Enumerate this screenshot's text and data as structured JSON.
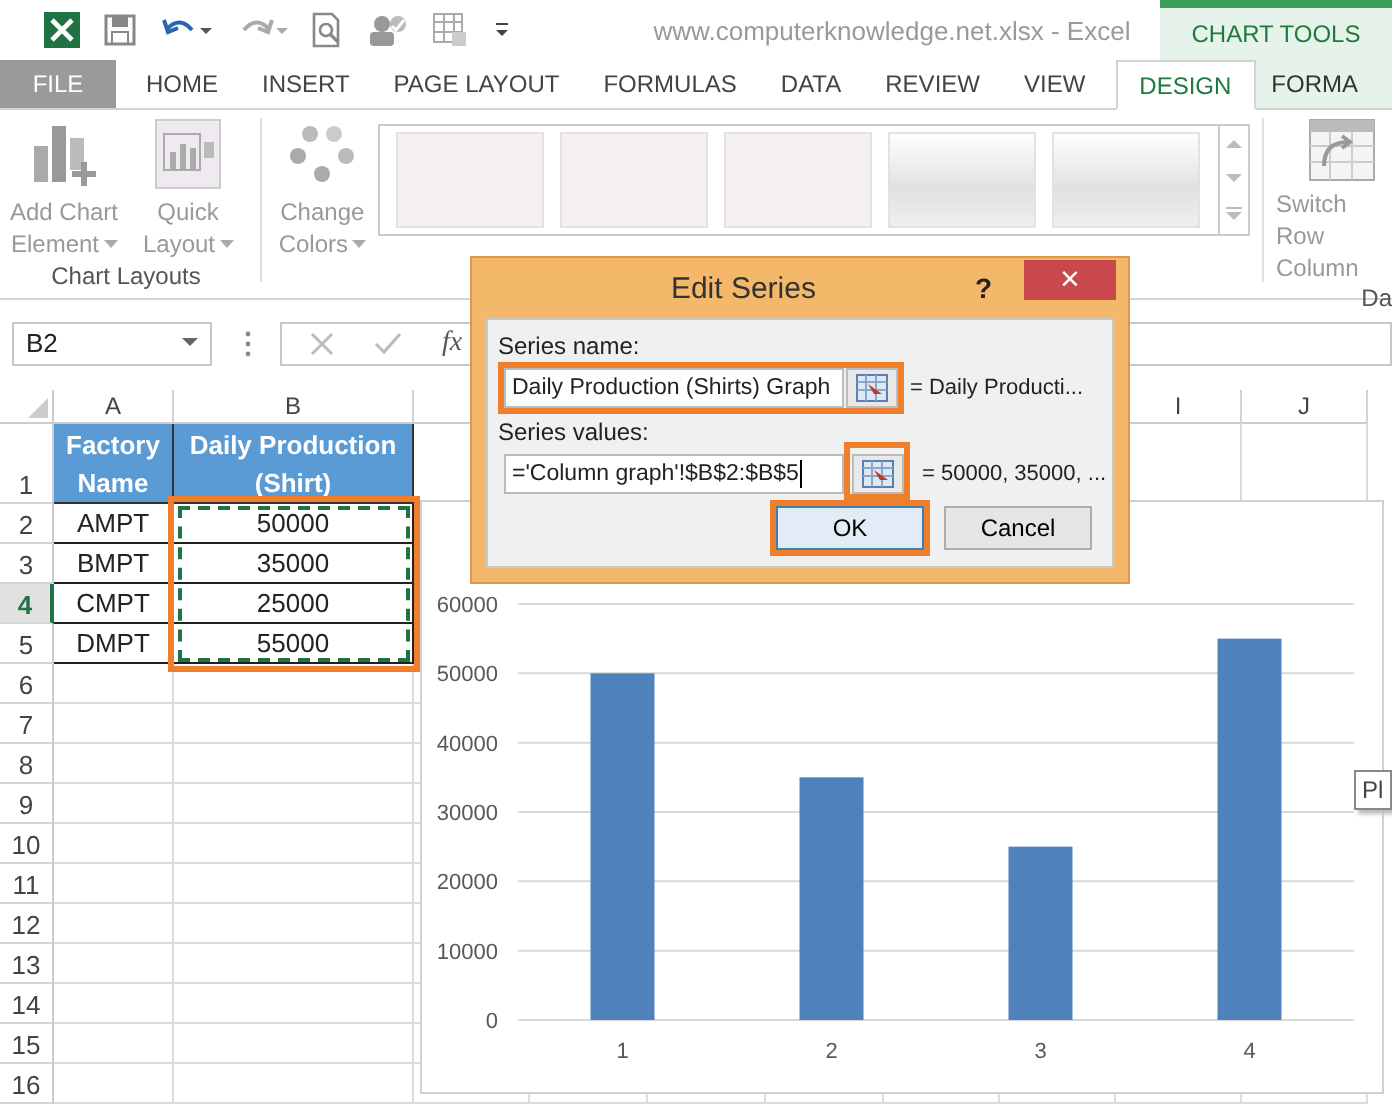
{
  "title_bar": {
    "title": "www.computerknowledge.net.xlsx - Excel",
    "context_label": "CHART TOOLS"
  },
  "tabs": [
    {
      "label": "FILE",
      "selected": false,
      "kind": "file"
    },
    {
      "label": "HOME",
      "selected": false,
      "kind": "main"
    },
    {
      "label": "INSERT",
      "selected": false,
      "kind": "main"
    },
    {
      "label": "PAGE LAYOUT",
      "selected": false,
      "kind": "main"
    },
    {
      "label": "FORMULAS",
      "selected": false,
      "kind": "main"
    },
    {
      "label": "DATA",
      "selected": false,
      "kind": "main"
    },
    {
      "label": "REVIEW",
      "selected": false,
      "kind": "main"
    },
    {
      "label": "VIEW",
      "selected": false,
      "kind": "main"
    },
    {
      "label": "DESIGN",
      "selected": true,
      "kind": "context"
    },
    {
      "label": "FORMA",
      "selected": false,
      "kind": "context"
    }
  ],
  "ribbon": {
    "groups": [
      {
        "label": "Chart Layouts",
        "buttons": [
          {
            "label": "Add Chart Element",
            "kind": "add-chart",
            "dropdown": true
          },
          {
            "label": "Quick Layout",
            "kind": "quick-layout",
            "dropdown": true
          }
        ]
      }
    ],
    "change_colors": {
      "label": "Change Colors",
      "kind": "change-colors",
      "dropdown": true
    },
    "switch": {
      "label": "Switch Row Column",
      "kind": "switch",
      "dropdown": false
    },
    "cut_group_label": "Da"
  },
  "formula_bar": {
    "name_box": "B2",
    "fx": "fx"
  },
  "sheet": {
    "columns": [
      "A",
      "B",
      "I",
      "J"
    ],
    "rows": [
      {
        "number": "1",
        "selected": false,
        "kind": "header",
        "cells": [
          "Factory Name",
          "Daily Production (Shirt)"
        ]
      },
      {
        "number": "2",
        "selected": false,
        "kind": "data",
        "cells": [
          "AMPT",
          "50000"
        ]
      },
      {
        "number": "3",
        "selected": false,
        "kind": "data",
        "cells": [
          "BMPT",
          "35000"
        ]
      },
      {
        "number": "4",
        "selected": true,
        "kind": "data",
        "cells": [
          "CMPT",
          "25000"
        ]
      },
      {
        "number": "5",
        "selected": false,
        "kind": "data",
        "cells": [
          "DMPT",
          "55000"
        ]
      },
      {
        "number": "6",
        "selected": false,
        "kind": "empty"
      },
      {
        "number": "7",
        "selected": false,
        "kind": "empty"
      },
      {
        "number": "8",
        "selected": false,
        "kind": "empty"
      },
      {
        "number": "9",
        "selected": false,
        "kind": "empty"
      },
      {
        "number": "10",
        "selected": false,
        "kind": "empty"
      },
      {
        "number": "11",
        "selected": false,
        "kind": "empty"
      },
      {
        "number": "12",
        "selected": false,
        "kind": "empty"
      },
      {
        "number": "13",
        "selected": false,
        "kind": "empty"
      },
      {
        "number": "14",
        "selected": false,
        "kind": "empty"
      },
      {
        "number": "15",
        "selected": false,
        "kind": "empty"
      },
      {
        "number": "16",
        "selected": false,
        "kind": "empty"
      }
    ]
  },
  "chart": {
    "chart_data": {
      "type": "bar",
      "categories": [
        "1",
        "2",
        "3",
        "4"
      ],
      "series": [
        {
          "color": "#4f81bd",
          "values": [
            50000,
            35000,
            25000,
            55000
          ]
        }
      ],
      "ylim": [
        0,
        60000
      ],
      "grid": true,
      "yticks": [
        0,
        10000,
        20000,
        30000,
        40000,
        50000,
        60000
      ]
    },
    "tooltip": "Pl"
  },
  "dialog": {
    "title": "Edit Series",
    "help": "?",
    "close": "×",
    "fields": [
      {
        "label": "Series name:",
        "value": "Daily Production (Shirts) Graph",
        "preview": "= Daily Producti...",
        "field_highlighted": true,
        "button_highlighted": false
      },
      {
        "label": "Series values:",
        "value": "='Column graph'!$B$2:$B$5",
        "preview": "= 50000, 35000, ...",
        "field_highlighted": false,
        "button_highlighted": true
      }
    ],
    "buttons": [
      {
        "label": "OK",
        "highlighted": true
      },
      {
        "label": "Cancel",
        "highlighted": false
      }
    ]
  }
}
